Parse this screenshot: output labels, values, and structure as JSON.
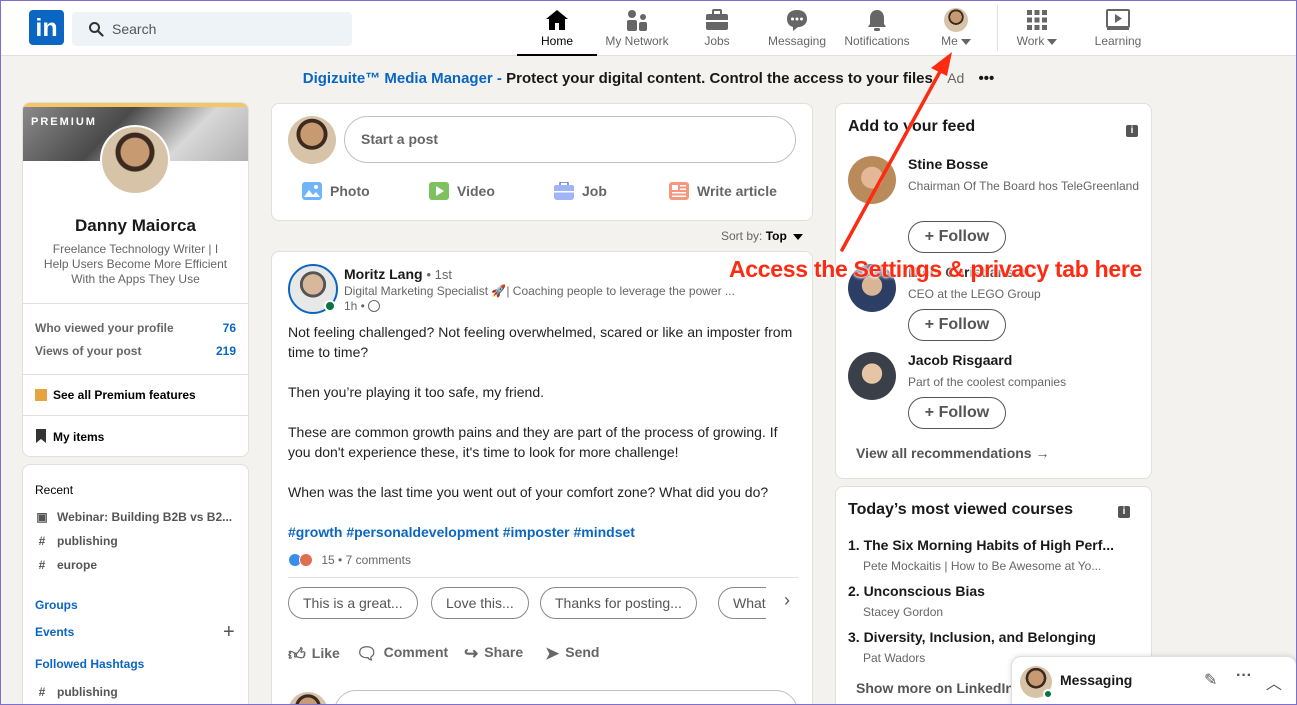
{
  "nav": {
    "search_placeholder": "Search",
    "items": [
      {
        "label": "Home"
      },
      {
        "label": "My Network"
      },
      {
        "label": "Jobs"
      },
      {
        "label": "Messaging"
      },
      {
        "label": "Notifications"
      },
      {
        "label": "Me"
      },
      {
        "label": "Work"
      },
      {
        "label": "Learning"
      }
    ]
  },
  "ad": {
    "brand": "Digizuite™ Media Manager -",
    "text": "Protect your digital content. Control the access to your files.",
    "tag": "Ad",
    "menu": "•••"
  },
  "profile": {
    "premium_label": "PREMIUM",
    "name": "Danny Maiorca",
    "headline": "Freelance Technology Writer | I Help Users Become More Efficient With the Apps They Use",
    "stats": [
      {
        "label": "Who viewed your profile",
        "value": "76"
      },
      {
        "label": "Views of your post",
        "value": "219"
      }
    ],
    "premium_link": "See all Premium features",
    "my_items": "My items"
  },
  "recent": {
    "title": "Recent",
    "items": [
      {
        "icon": "calendar-icon",
        "label": "Webinar: Building B2B vs B2..."
      },
      {
        "icon": "hashtag-icon",
        "label": "publishing"
      },
      {
        "icon": "hashtag-icon",
        "label": "europe"
      }
    ],
    "groups": "Groups",
    "events": "Events",
    "followed_hashtags": "Followed Hashtags",
    "followed_items": [
      {
        "label": "publishing"
      }
    ]
  },
  "share": {
    "placeholder": "Start a post",
    "actions": [
      {
        "label": "Photo",
        "color": "#70b5f9"
      },
      {
        "label": "Video",
        "color": "#7fc15e"
      },
      {
        "label": "Job",
        "color": "#a0b4f7"
      },
      {
        "label": "Write article",
        "color": "#e7a33e"
      }
    ]
  },
  "sort": {
    "label": "Sort by:",
    "value": "Top"
  },
  "post": {
    "author": "Moritz Lang",
    "degree": "• 1st",
    "subtitle": "Digital Marketing Specialist 🚀| Coaching people to leverage the power ...",
    "time": "1h •",
    "paragraphs": [
      "Not feeling challenged? Not feeling overwhelmed, scared or like an imposter from time to time?",
      "Then you’re playing it too safe, my friend.",
      "These are common growth pains and they are part of the process of growing. If you don't experience these, it's time to look for more challenge!",
      "When was the last time you went out of your comfort zone? What did you do?"
    ],
    "hashtags": "#growth #personaldevelopment #imposter #mindset",
    "reactions": "15",
    "comments": "• 7 comments",
    "suggestions": [
      {
        "label": "This is a great..."
      },
      {
        "label": "Love this..."
      },
      {
        "label": "Thanks for posting..."
      },
      {
        "label": "What..."
      }
    ],
    "actions": [
      {
        "label": "Like"
      },
      {
        "label": "Comment"
      },
      {
        "label": "Share"
      },
      {
        "label": "Send"
      }
    ]
  },
  "feed": {
    "title": "Add to your feed",
    "people": [
      {
        "name": "Stine Bosse",
        "subtitle": "Chairman Of The Board hos TeleGreenland"
      },
      {
        "name": "Niels Christiansen",
        "subtitle": "CEO at the LEGO Group"
      },
      {
        "name": "Jacob Risgaard",
        "subtitle": "Part of the coolest companies"
      }
    ],
    "follow_label": "Follow",
    "view_all": "View all recommendations →"
  },
  "courses": {
    "title": "Today’s most viewed courses",
    "items": [
      {
        "title": "1. The Six Morning Habits of High Perf...",
        "author": "Pete Mockaitis | How to Be Awesome at Yo..."
      },
      {
        "title": "2. Unconscious Bias",
        "author": "Stacey Gordon"
      },
      {
        "title": "3. Diversity, Inclusion, and Belonging",
        "author": "Pat Wadors"
      }
    ],
    "show_more": "Show more on LinkedIn Learning"
  },
  "messaging": {
    "label": "Messaging"
  },
  "annotation": {
    "text": "Access the Settings & privacy tab here",
    "color": "#ff2a12"
  }
}
